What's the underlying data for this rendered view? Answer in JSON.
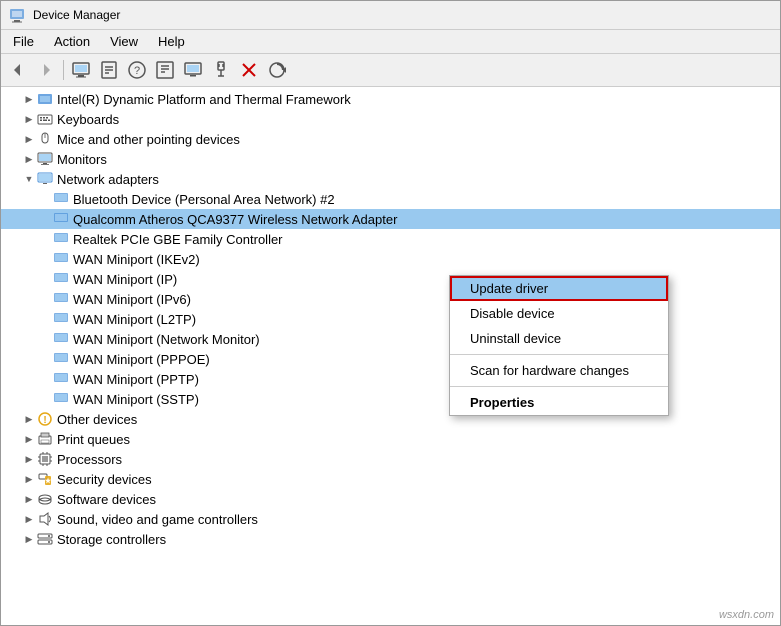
{
  "window": {
    "title": "Device Manager",
    "icon": "device-manager"
  },
  "menu": {
    "items": [
      "File",
      "Action",
      "View",
      "Help"
    ]
  },
  "toolbar": {
    "buttons": [
      "back",
      "forward",
      "computer",
      "properties",
      "help",
      "properties2",
      "monitor",
      "plug",
      "delete",
      "refresh"
    ]
  },
  "tree": {
    "items": [
      {
        "label": "Intel(R) Dynamic Platform and Thermal Framework",
        "level": 1,
        "icon": "cpu",
        "expanded": false,
        "has_children": true
      },
      {
        "label": "Keyboards",
        "level": 1,
        "icon": "keyboard",
        "expanded": false,
        "has_children": true
      },
      {
        "label": "Mice and other pointing devices",
        "level": 1,
        "icon": "mouse",
        "expanded": false,
        "has_children": true
      },
      {
        "label": "Monitors",
        "level": 1,
        "icon": "monitor",
        "expanded": false,
        "has_children": true
      },
      {
        "label": "Network adapters",
        "level": 1,
        "icon": "network",
        "expanded": true,
        "has_children": true
      },
      {
        "label": "Bluetooth Device (Personal Area Network) #2",
        "level": 2,
        "icon": "network-card",
        "expanded": false,
        "has_children": false
      },
      {
        "label": "Qualcomm Atheros QCA9377 Wireless Network Adapter",
        "level": 2,
        "icon": "network-card",
        "expanded": false,
        "has_children": false,
        "selected": true
      },
      {
        "label": "Realtek PCIe GBE Family Controller",
        "level": 2,
        "icon": "network-card",
        "expanded": false,
        "has_children": false
      },
      {
        "label": "WAN Miniport (IKEv2)",
        "level": 2,
        "icon": "network-card",
        "expanded": false,
        "has_children": false
      },
      {
        "label": "WAN Miniport (IP)",
        "level": 2,
        "icon": "network-card",
        "expanded": false,
        "has_children": false
      },
      {
        "label": "WAN Miniport (IPv6)",
        "level": 2,
        "icon": "network-card",
        "expanded": false,
        "has_children": false
      },
      {
        "label": "WAN Miniport (L2TP)",
        "level": 2,
        "icon": "network-card",
        "expanded": false,
        "has_children": false
      },
      {
        "label": "WAN Miniport (Network Monitor)",
        "level": 2,
        "icon": "network-card",
        "expanded": false,
        "has_children": false
      },
      {
        "label": "WAN Miniport (PPPOE)",
        "level": 2,
        "icon": "network-card",
        "expanded": false,
        "has_children": false
      },
      {
        "label": "WAN Miniport (PPTP)",
        "level": 2,
        "icon": "network-card",
        "expanded": false,
        "has_children": false
      },
      {
        "label": "WAN Miniport (SSTP)",
        "level": 2,
        "icon": "network-card",
        "expanded": false,
        "has_children": false
      },
      {
        "label": "Other devices",
        "level": 1,
        "icon": "other",
        "expanded": false,
        "has_children": true
      },
      {
        "label": "Print queues",
        "level": 1,
        "icon": "printer",
        "expanded": false,
        "has_children": true
      },
      {
        "label": "Processors",
        "level": 1,
        "icon": "processor",
        "expanded": false,
        "has_children": true
      },
      {
        "label": "Security devices",
        "level": 1,
        "icon": "security",
        "expanded": false,
        "has_children": true
      },
      {
        "label": "Software devices",
        "level": 1,
        "icon": "software",
        "expanded": false,
        "has_children": true
      },
      {
        "label": "Sound, video and game controllers",
        "level": 1,
        "icon": "sound",
        "expanded": false,
        "has_children": true
      },
      {
        "label": "Storage controllers",
        "level": 1,
        "icon": "storage",
        "expanded": false,
        "has_children": true
      }
    ]
  },
  "context_menu": {
    "items": [
      {
        "label": "Update driver",
        "type": "highlighted"
      },
      {
        "label": "Disable device",
        "type": "normal"
      },
      {
        "label": "Uninstall device",
        "type": "normal"
      },
      {
        "label": "separator"
      },
      {
        "label": "Scan for hardware changes",
        "type": "normal"
      },
      {
        "label": "separator"
      },
      {
        "label": "Properties",
        "type": "bold"
      }
    ]
  },
  "watermark": "wsxdn.com"
}
